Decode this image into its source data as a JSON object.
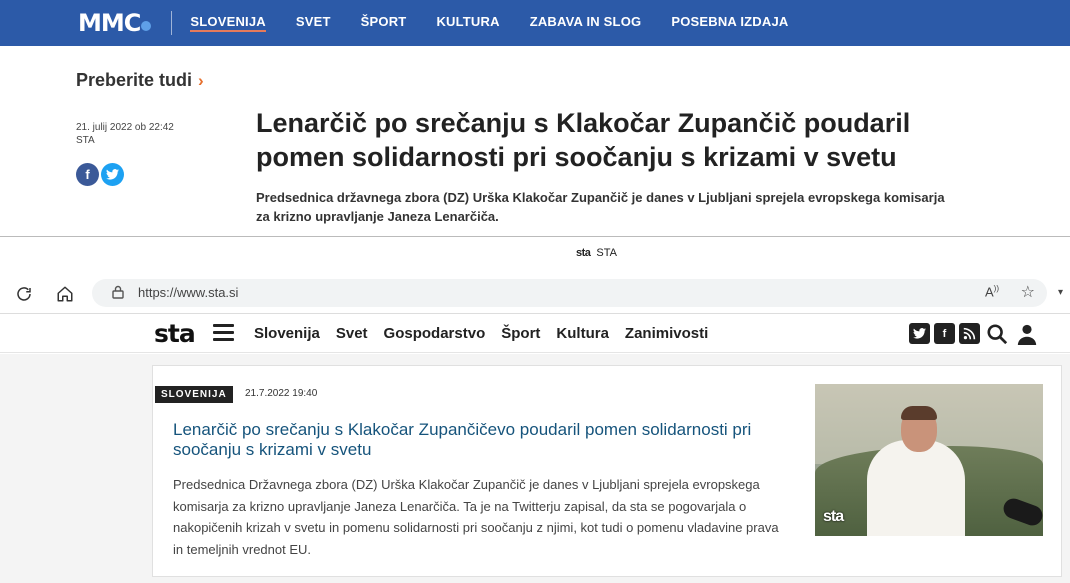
{
  "mmc": {
    "logo": "MMC",
    "nav": [
      "SLOVENIJA",
      "SVET",
      "ŠPORT",
      "KULTURA",
      "ZABAVA IN SLOG",
      "POSEBNA IZDAJA"
    ],
    "preberite": "Preberite tudi",
    "date": "21. julij 2022 ob 22:42",
    "source": "STA",
    "headline": "Lenarčič po srečanju s Klakočar Zupančič poudaril pomen solidarnosti pri soočanju s krizami v svetu",
    "lead": "Predsednica državnega zbora (DZ) Urška Klakočar Zupančič je danes v Ljubljani sprejela evropskega komisarja za krizno upravljanje Janeza Lenarčiča."
  },
  "browser": {
    "tab_title": "STA",
    "tab_logo": "sta",
    "url": "https://www.sta.si",
    "reader_label": "A"
  },
  "sta": {
    "logo": "sta",
    "nav": [
      "Slovenija",
      "Svet",
      "Gospodarstvo",
      "Šport",
      "Kultura",
      "Zanimivosti"
    ],
    "card": {
      "tag": "SLOVENIJA",
      "date": "21.7.2022 19:40",
      "title": "Lenarčič po srečanju s Klakočar Zupančičevo poudaril pomen solidarnosti pri soočanju s krizami v svetu",
      "text": "Predsednica Državnega zbora (DZ) Urška Klakočar Zupančič je danes v Ljubljani sprejela evropskega komisarja za krizno upravljanje Janeza Lenarčiča. Ta je na Twitterju zapisal, da sta se pogovarjala o nakopičenih krizah v svetu in pomenu solidarnosti pri soočanju z njimi, kot tudi o pomenu vladavine prava in temeljnih vrednot EU.",
      "photo_watermark": "sta"
    }
  },
  "colors": {
    "mmc_blue": "#2c5aa8",
    "accent_orange": "#e6702e",
    "sta_title_blue": "#16547c"
  }
}
